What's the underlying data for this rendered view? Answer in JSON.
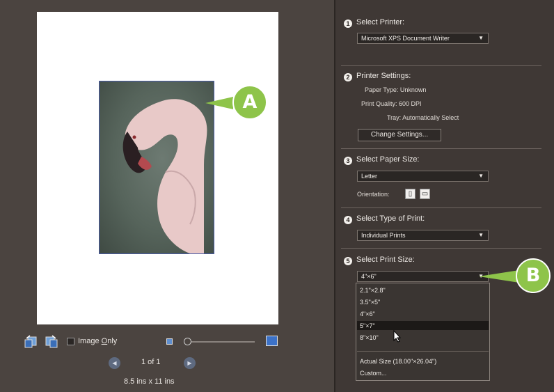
{
  "preview": {
    "callout_a": "A",
    "image_only_label": "Image ",
    "image_only_label_u": "O",
    "image_only_label_rest": "nly",
    "page_indicator": "1 of 1",
    "paper_dimensions": "8.5 ins x 11 ins"
  },
  "sections": {
    "printer": {
      "num": "1",
      "title": "Select Printer:",
      "value": "Microsoft XPS Document Writer"
    },
    "settings": {
      "num": "2",
      "title": "Printer Settings:",
      "paper_type": "Paper Type: Unknown",
      "print_quality": "Print Quality: 600 DPI",
      "tray": "Tray: Automatically Select",
      "change_button": "Change Settings..."
    },
    "paper": {
      "num": "3",
      "title": "Select Paper Size:",
      "value": "Letter",
      "orientation_label": "Orientation:"
    },
    "print_type": {
      "num": "4",
      "title": "Select Type of Print:",
      "value": "Individual Prints"
    },
    "print_size": {
      "num": "5",
      "title": "Select Print Size:",
      "value": "4\"×6\"",
      "options": [
        "2.1\"×2.8\"",
        "3.5\"×5\"",
        "4\"×6\"",
        "5\"×7\"",
        "8\"×10\"",
        "Actual Size (18.00\"×26.04\")",
        "Custom..."
      ],
      "highlighted": "5\"×7\""
    },
    "callout_b": "B"
  },
  "colors": {
    "callout_green": "#8ec44a",
    "panel_bg": "#3f3835",
    "preview_bg": "#4b4440"
  }
}
